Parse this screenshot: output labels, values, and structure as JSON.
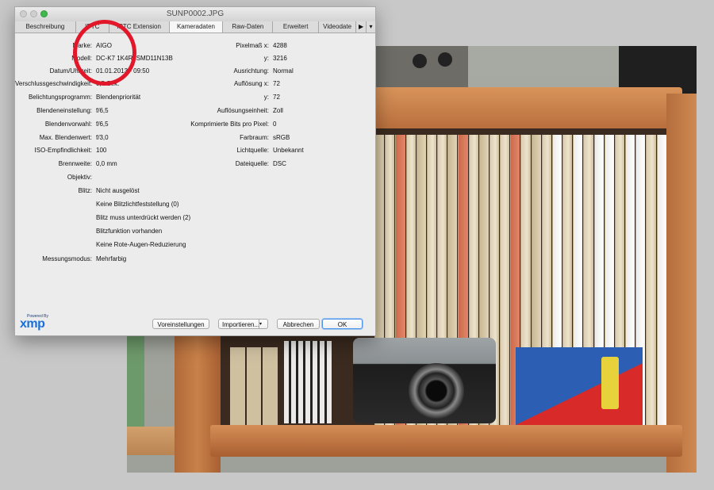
{
  "window": {
    "title": "SUNP0002.JPG"
  },
  "tabs": [
    {
      "label": "Beschreibung"
    },
    {
      "label": "IPTC"
    },
    {
      "label": "IPTC Extension"
    },
    {
      "label": "Kameradaten",
      "active": true
    },
    {
      "label": "Raw-Daten"
    },
    {
      "label": "Erweitert"
    },
    {
      "label": "Videodate"
    }
  ],
  "tab_overflow_icon": "triangle-right-icon",
  "tab_menu_icon": "triangle-down-icon",
  "left_fields": [
    {
      "label": "Marke:",
      "value": "AIGO"
    },
    {
      "label": "Modell:",
      "value": "DC-K7 1K4R5SMD11N13B"
    },
    {
      "label": "Datum/Uhrzeit:",
      "value": "01.01.2013 - 09:50"
    },
    {
      "label": "Verschlussgeschwindigkeit:",
      "value": "0,5 Sek."
    },
    {
      "label": "Belichtungsprogramm:",
      "value": "Blendenpriorität"
    },
    {
      "label": "Blendeneinstellung:",
      "value": "f/6,5"
    },
    {
      "label": "Blendenvorwahl:",
      "value": "f/6,5"
    },
    {
      "label": "Max. Blendenwert:",
      "value": "f/3,0"
    },
    {
      "label": "ISO-Empfindlichkeit:",
      "value": "100"
    },
    {
      "label": "Brennweite:",
      "value": "0,0 mm"
    },
    {
      "label": "Objektiv:",
      "value": ""
    },
    {
      "label": "Blitz:",
      "value": "Nicht ausgelöst"
    }
  ],
  "flash_details": [
    "Keine Blitzlichtfeststellung (0)",
    "Blitz muss unterdrückt werden (2)",
    "Blitzfunktion vorhanden",
    "Keine Rote-Augen-Reduzierung"
  ],
  "metering": {
    "label": "Messungsmodus:",
    "value": "Mehrfarbig"
  },
  "right_fields": [
    {
      "label": "Pixelmaß x:",
      "value": "4288"
    },
    {
      "label": "y:",
      "value": "3216"
    },
    {
      "label": "Ausrichtung:",
      "value": "Normal"
    },
    {
      "label": "Auflösung x:",
      "value": "72"
    },
    {
      "label": "y:",
      "value": "72"
    },
    {
      "label": "Auflösungseinheit:",
      "value": "Zoll"
    },
    {
      "label": "Komprimierte Bits pro Pixel:",
      "value": "0"
    },
    {
      "label": "Farbraum:",
      "value": "sRGB"
    },
    {
      "label": "Lichtquelle:",
      "value": "Unbekannt"
    },
    {
      "label": "Dateiquelle:",
      "value": "DSC"
    }
  ],
  "logo": {
    "powered_by": "Powered By",
    "brand": "xmp"
  },
  "buttons": {
    "preferences": "Voreinstellungen",
    "import": "Importieren...",
    "cancel": "Abbrechen",
    "ok": "OK"
  },
  "colors": {
    "annotation_circle": "#e2182a",
    "ok_focus": "#4f93e6",
    "xmp_brand": "#1c6fd8"
  }
}
